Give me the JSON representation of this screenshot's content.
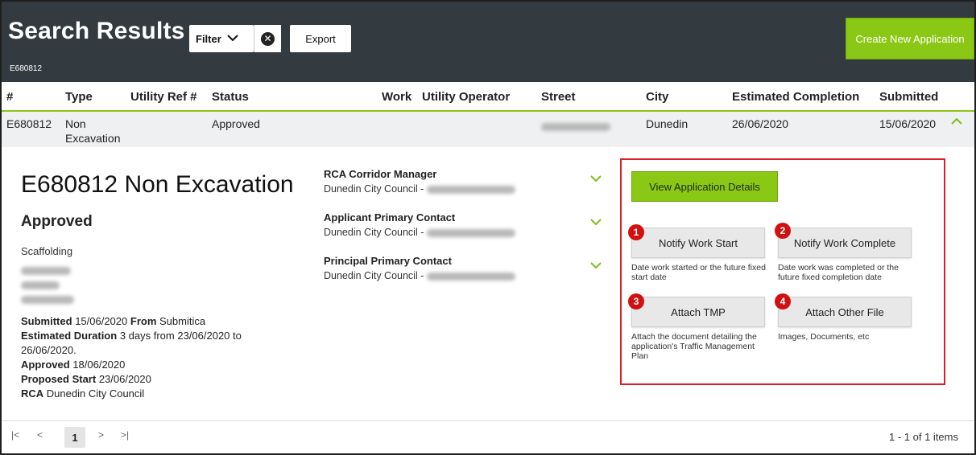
{
  "header": {
    "title": "Search Results",
    "filter_label": "Filter",
    "export_label": "Export",
    "create_label": "Create New Application",
    "current_id": "E680812"
  },
  "table": {
    "columns": [
      "#",
      "Type",
      "Utility Ref #",
      "Status",
      "Work",
      "Utility Operator",
      "Street",
      "City",
      "Estimated Completion",
      "Submitted"
    ],
    "row": {
      "id": "E680812",
      "type": "Non Excavation",
      "utility_ref": "",
      "status": "Approved",
      "work": "",
      "utility_operator": "",
      "city": "Dunedin",
      "estimated_completion": "26/06/2020",
      "submitted": "15/06/2020"
    }
  },
  "detail": {
    "title": "E680812 Non Excavation",
    "status": "Approved",
    "work_type": "Scaffolding",
    "submitted_label": "Submitted",
    "submitted_value": "15/06/2020",
    "from_label": "From",
    "from_value": "Submitica",
    "est_duration_label": "Estimated Duration",
    "est_duration_value": "3 days from 23/06/2020 to 26/06/2020.",
    "approved_label": "Approved",
    "approved_value": "18/06/2020",
    "proposed_start_label": "Proposed Start",
    "proposed_start_value": "23/06/2020",
    "rca_label": "RCA",
    "rca_value": "Dunedin City Council"
  },
  "contacts": [
    {
      "role": "RCA Corridor Manager",
      "org": "Dunedin City Council - "
    },
    {
      "role": "Applicant Primary Contact",
      "org": "Dunedin City Council - "
    },
    {
      "role": "Principal Primary Contact",
      "org": "Dunedin City Council - "
    }
  ],
  "actions": {
    "view_details": "View Application Details",
    "notify_start": {
      "badge": "1",
      "label": "Notify Work Start",
      "hint": "Date work started or the future fixed start date"
    },
    "notify_complete": {
      "badge": "2",
      "label": "Notify Work Complete",
      "hint": "Date work was completed or the future fixed completion date"
    },
    "attach_tmp": {
      "badge": "3",
      "label": "Attach TMP",
      "hint": "Attach the document detailing the application's Traffic Management Plan"
    },
    "attach_other": {
      "badge": "4",
      "label": "Attach Other File",
      "hint": "Images, Documents, etc"
    }
  },
  "pagination": {
    "first": "|<",
    "prev": "<",
    "current_page": "1",
    "next": ">",
    "last": ">|",
    "summary": "1 - 1 of 1 items"
  },
  "colors": {
    "header_bg": "#333a40",
    "accent_green": "#8ac815",
    "highlight_red": "#d9202a",
    "badge_red": "#d21010"
  }
}
